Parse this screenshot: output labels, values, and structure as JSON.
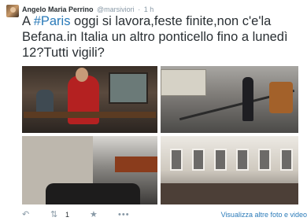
{
  "tweet": {
    "author_name": "Angelo Maria Perrino",
    "handle": "@marsiviori",
    "separator": "·",
    "time": "1 h",
    "text_prefix": "A ",
    "hashtag": "#Paris",
    "text_rest": " oggi si lavora,feste finite,non c'e'la Befana.in Italia un altro ponticello fino a lunedì 12?Tutti vigili?"
  },
  "actions": {
    "reply_icon": "reply-icon",
    "retweet_icon": "retweet-icon",
    "retweet_count": "1",
    "favorite_icon": "star-icon",
    "more_icon": "more-icon",
    "media_link": "Visualizza altre foto e video"
  },
  "colors": {
    "text": "#292f33",
    "muted": "#8899a6",
    "link": "#2b7bb9"
  }
}
